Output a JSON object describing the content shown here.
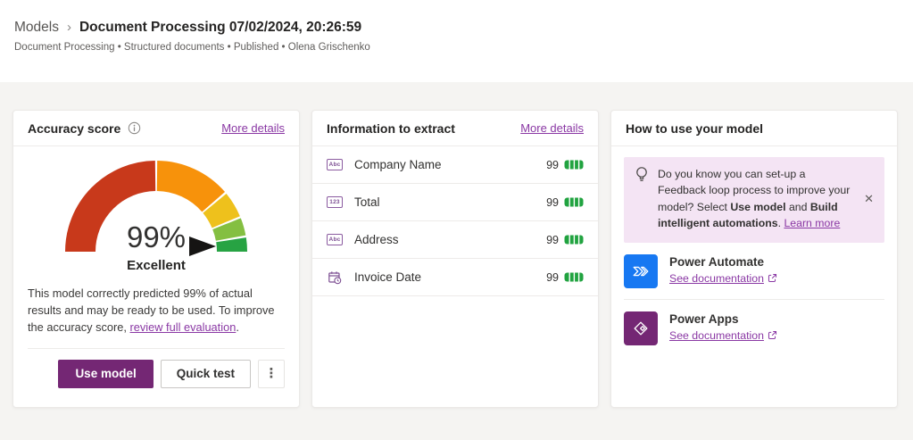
{
  "header": {
    "breadcrumb": "Models",
    "separator": "›",
    "title": "Document Processing 07/02/2024, 20:26:59",
    "meta": "Document Processing • Structured documents • Published • Olena Grischenko"
  },
  "accuracy": {
    "title": "Accuracy score",
    "more_details": "More details",
    "value_text": "99%",
    "value_label": "Excellent",
    "desc_pre": "This model correctly predicted 99% of actual results and may be ready to be used. To improve the accuracy score, ",
    "desc_link": "review full evaluation",
    "desc_post": ".",
    "use_model_label": "Use model",
    "quick_test_label": "Quick test",
    "kebab_icon": "⋮",
    "gauge": {
      "type": "gauge",
      "value": 99,
      "label": "Excellent",
      "range": [
        0,
        100
      ],
      "segments": [
        {
          "name": "poor",
          "from": 0,
          "to": 50,
          "color": "#c8391b"
        },
        {
          "name": "fair",
          "from": 50,
          "to": 77,
          "color": "#f7920b"
        },
        {
          "name": "good",
          "from": 77,
          "to": 87,
          "color": "#eec11c"
        },
        {
          "name": "very-good",
          "from": 87,
          "to": 94,
          "color": "#84bf41"
        },
        {
          "name": "excellent",
          "from": 94,
          "to": 100,
          "color": "#27a343"
        }
      ]
    }
  },
  "extract": {
    "title": "Information to extract",
    "more_details": "More details",
    "rows": [
      {
        "type": "text",
        "icon_text": "Abc",
        "label": "Company Name",
        "score": "99"
      },
      {
        "type": "number",
        "icon_text": "123",
        "label": "Total",
        "score": "99"
      },
      {
        "type": "text",
        "icon_text": "Abc",
        "label": "Address",
        "score": "99"
      },
      {
        "type": "date",
        "label": "Invoice Date",
        "score": "99"
      }
    ]
  },
  "howto": {
    "title": "How to use your model",
    "banner": {
      "text_1": "Do you know you can set-up a Feedback loop process to improve your model? Select ",
      "bold_1": "Use model",
      "text_2": " and ",
      "bold_2": "Build intelligent automations",
      "text_3": ". ",
      "link_label": "Learn more",
      "close_icon": "✕"
    },
    "items": [
      {
        "name": "Power Automate",
        "link_label": "See documentation",
        "brand_color": "#1778f2"
      },
      {
        "name": "Power Apps",
        "link_label": "See documentation",
        "brand_color": "#742774"
      }
    ]
  },
  "colors": {
    "link": "#8a38a4",
    "primary_button": "#742774",
    "banner_bg": "#f4e4f4",
    "score_indicator": "#21a340",
    "page_background": "#f5f4f2"
  }
}
